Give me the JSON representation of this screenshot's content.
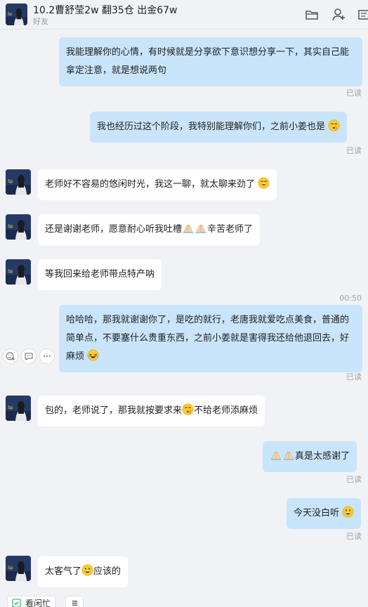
{
  "header": {
    "contact_name": "10.2曹舒莹2w 翻35仓 出金67w",
    "contact_sub": "好友"
  },
  "messages": [
    {
      "direction": "out",
      "text": "我能理解你的心情，有时候就是分享欲下意识想分享一下，其实自己能拿定注意，就是想说两句",
      "status": "已读"
    },
    {
      "direction": "out",
      "text": "我也经历过这个阶段，我特别能理解你们，之前小姜也是",
      "status": "已读",
      "emoji": "shush-face"
    },
    {
      "direction": "in",
      "text": "老师好不容易的悠闲时光，我这一聊，就太聊来劲了",
      "emoji": "grinning-sweat-face"
    },
    {
      "direction": "in",
      "text_before": "还是谢谢老师，愿意耐心听我吐槽",
      "text_after": "辛苦老师了",
      "emoji": "praying-hands"
    },
    {
      "direction": "in",
      "text": "等我回来给老师带点特产呐"
    },
    {
      "timestamp": "00:50"
    },
    {
      "direction": "out",
      "text": "哈哈哈，那我就谢谢你了，是吃的就行，老唐我就爱吃点美食，普通的简单点，不要塞什么贵重东西，之前小姜就是害得我还给他退回去，好麻烦",
      "status": "已读",
      "emoji": "laughing-tears-face"
    },
    {
      "direction": "in",
      "text_before": "包的，老师说了，那我就按要求来",
      "text_after": "不给老师添麻烦",
      "emoji": "shush-face"
    },
    {
      "direction": "out",
      "text": "真是太感谢了",
      "status": "已读",
      "emoji": "praying-hands"
    },
    {
      "direction": "out",
      "text": "今天没白听",
      "status": "已读",
      "emoji": "grinning-face"
    },
    {
      "direction": "in",
      "text_before": "太客气了",
      "text_after": "应该的",
      "emoji": "grinning-face"
    }
  ],
  "toolbar": {
    "busy_label": "看闲忙",
    "menu_icon": "menu-icon"
  },
  "colors": {
    "background": "#f1f2f6",
    "outgoing_bubble": "#c9e5fb",
    "incoming_bubble": "#ffffff",
    "status_text": "#a3a3a3",
    "busy_check": "#2fb56a"
  }
}
